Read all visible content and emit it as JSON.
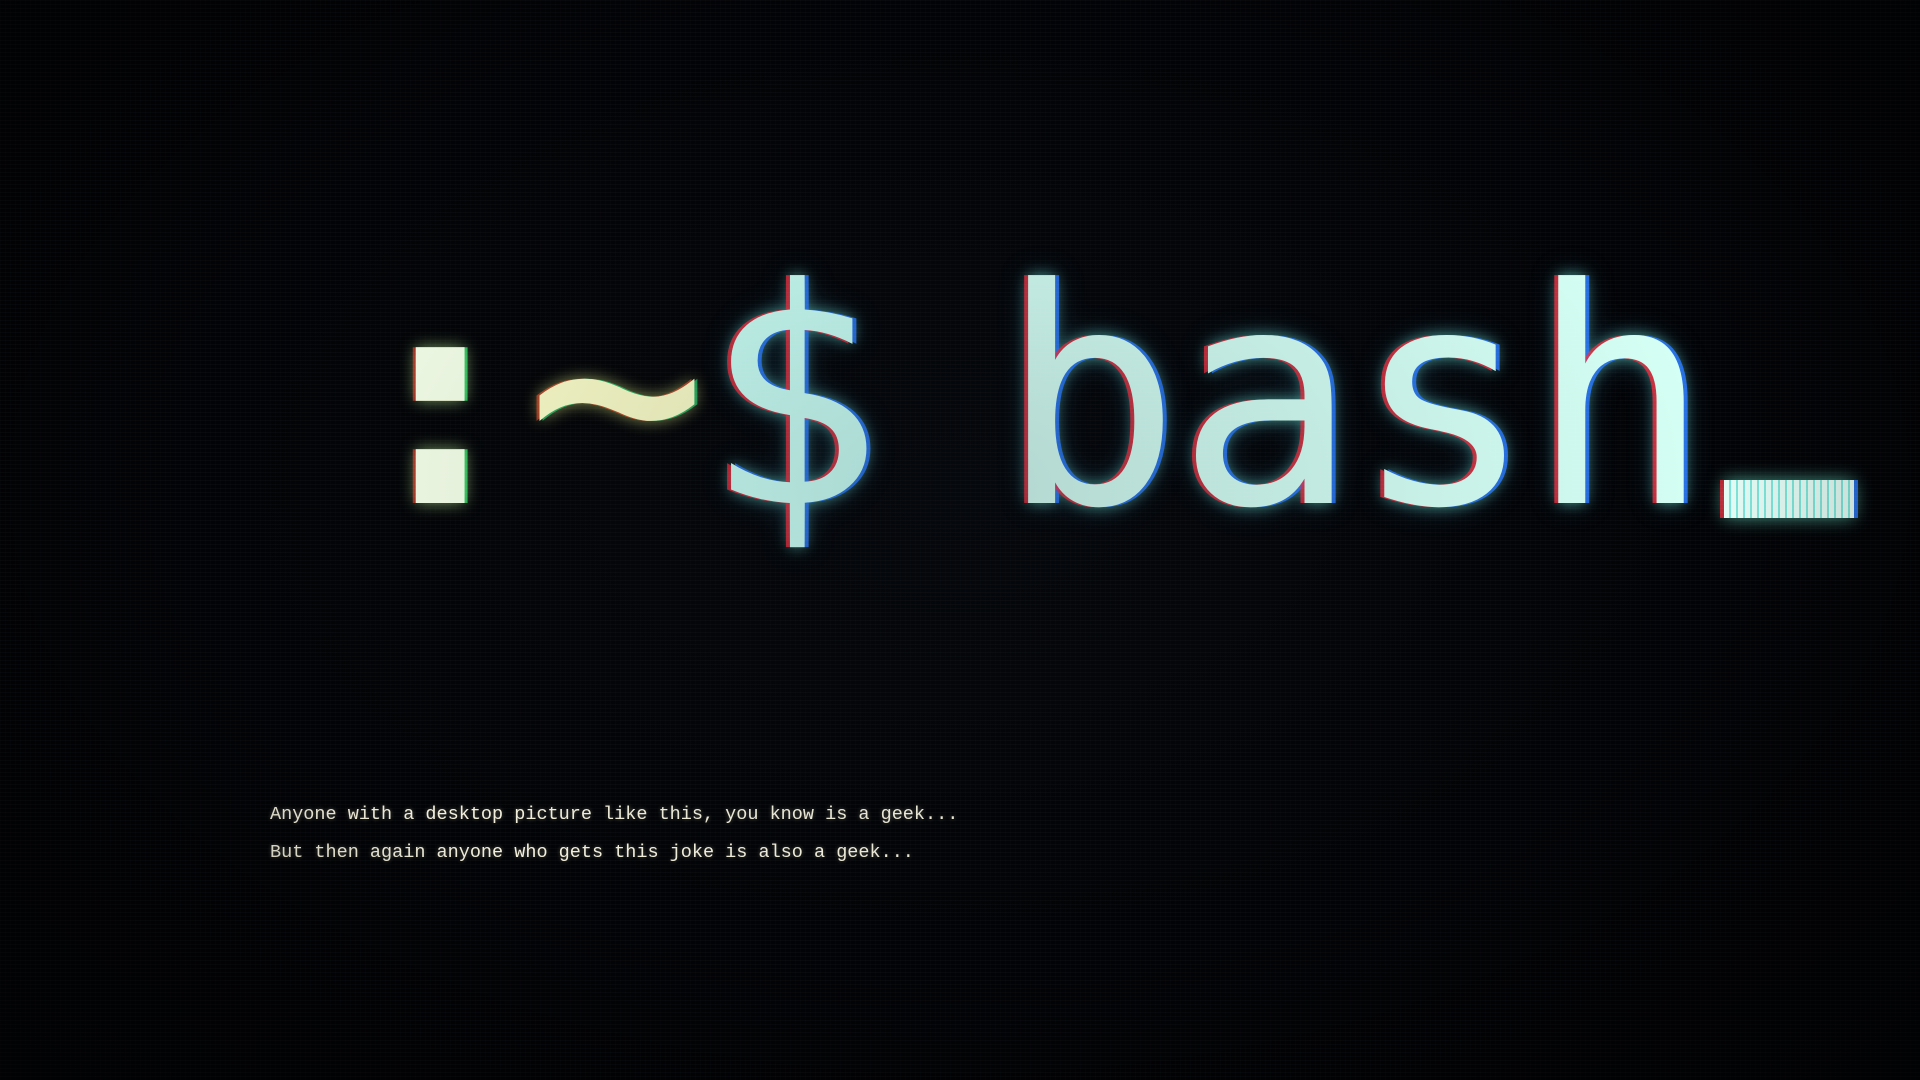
{
  "prompt": {
    "colon": ":",
    "tilde": "~",
    "dollar": "$",
    "command": "bash"
  },
  "caption": {
    "line1": "Anyone with a desktop picture like this, you know is a geek...",
    "line2": "But then again anyone who gets this joke is also a geek..."
  },
  "colors": {
    "background": "#020306",
    "text_glow": "#d8fff6",
    "caption_text": "#f3f0dc"
  }
}
